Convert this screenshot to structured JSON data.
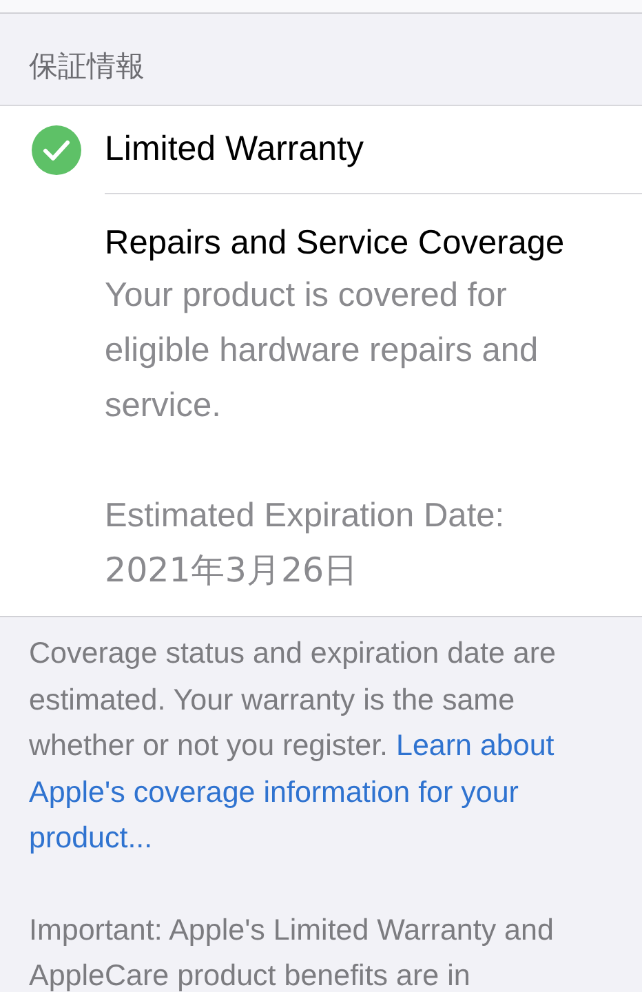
{
  "section_header": "保証情報",
  "warranty": {
    "title": "Limited Warranty",
    "active": true
  },
  "coverage": {
    "title": "Repairs and Service Coverage",
    "description": "Your product is covered for eligible hardware repairs and service.",
    "expiration_label": "Estimated Expiration Date:",
    "expiration_date": "2021年3月26日"
  },
  "footer": {
    "text": "Coverage status and expiration date are estimated. Your warranty is the same whether or not you register.",
    "link_lines": [
      "Learn about",
      "Apple's coverage information for your",
      "product..."
    ],
    "important": "Important: Apple's Limited Warranty and AppleCare product benefits are in"
  }
}
